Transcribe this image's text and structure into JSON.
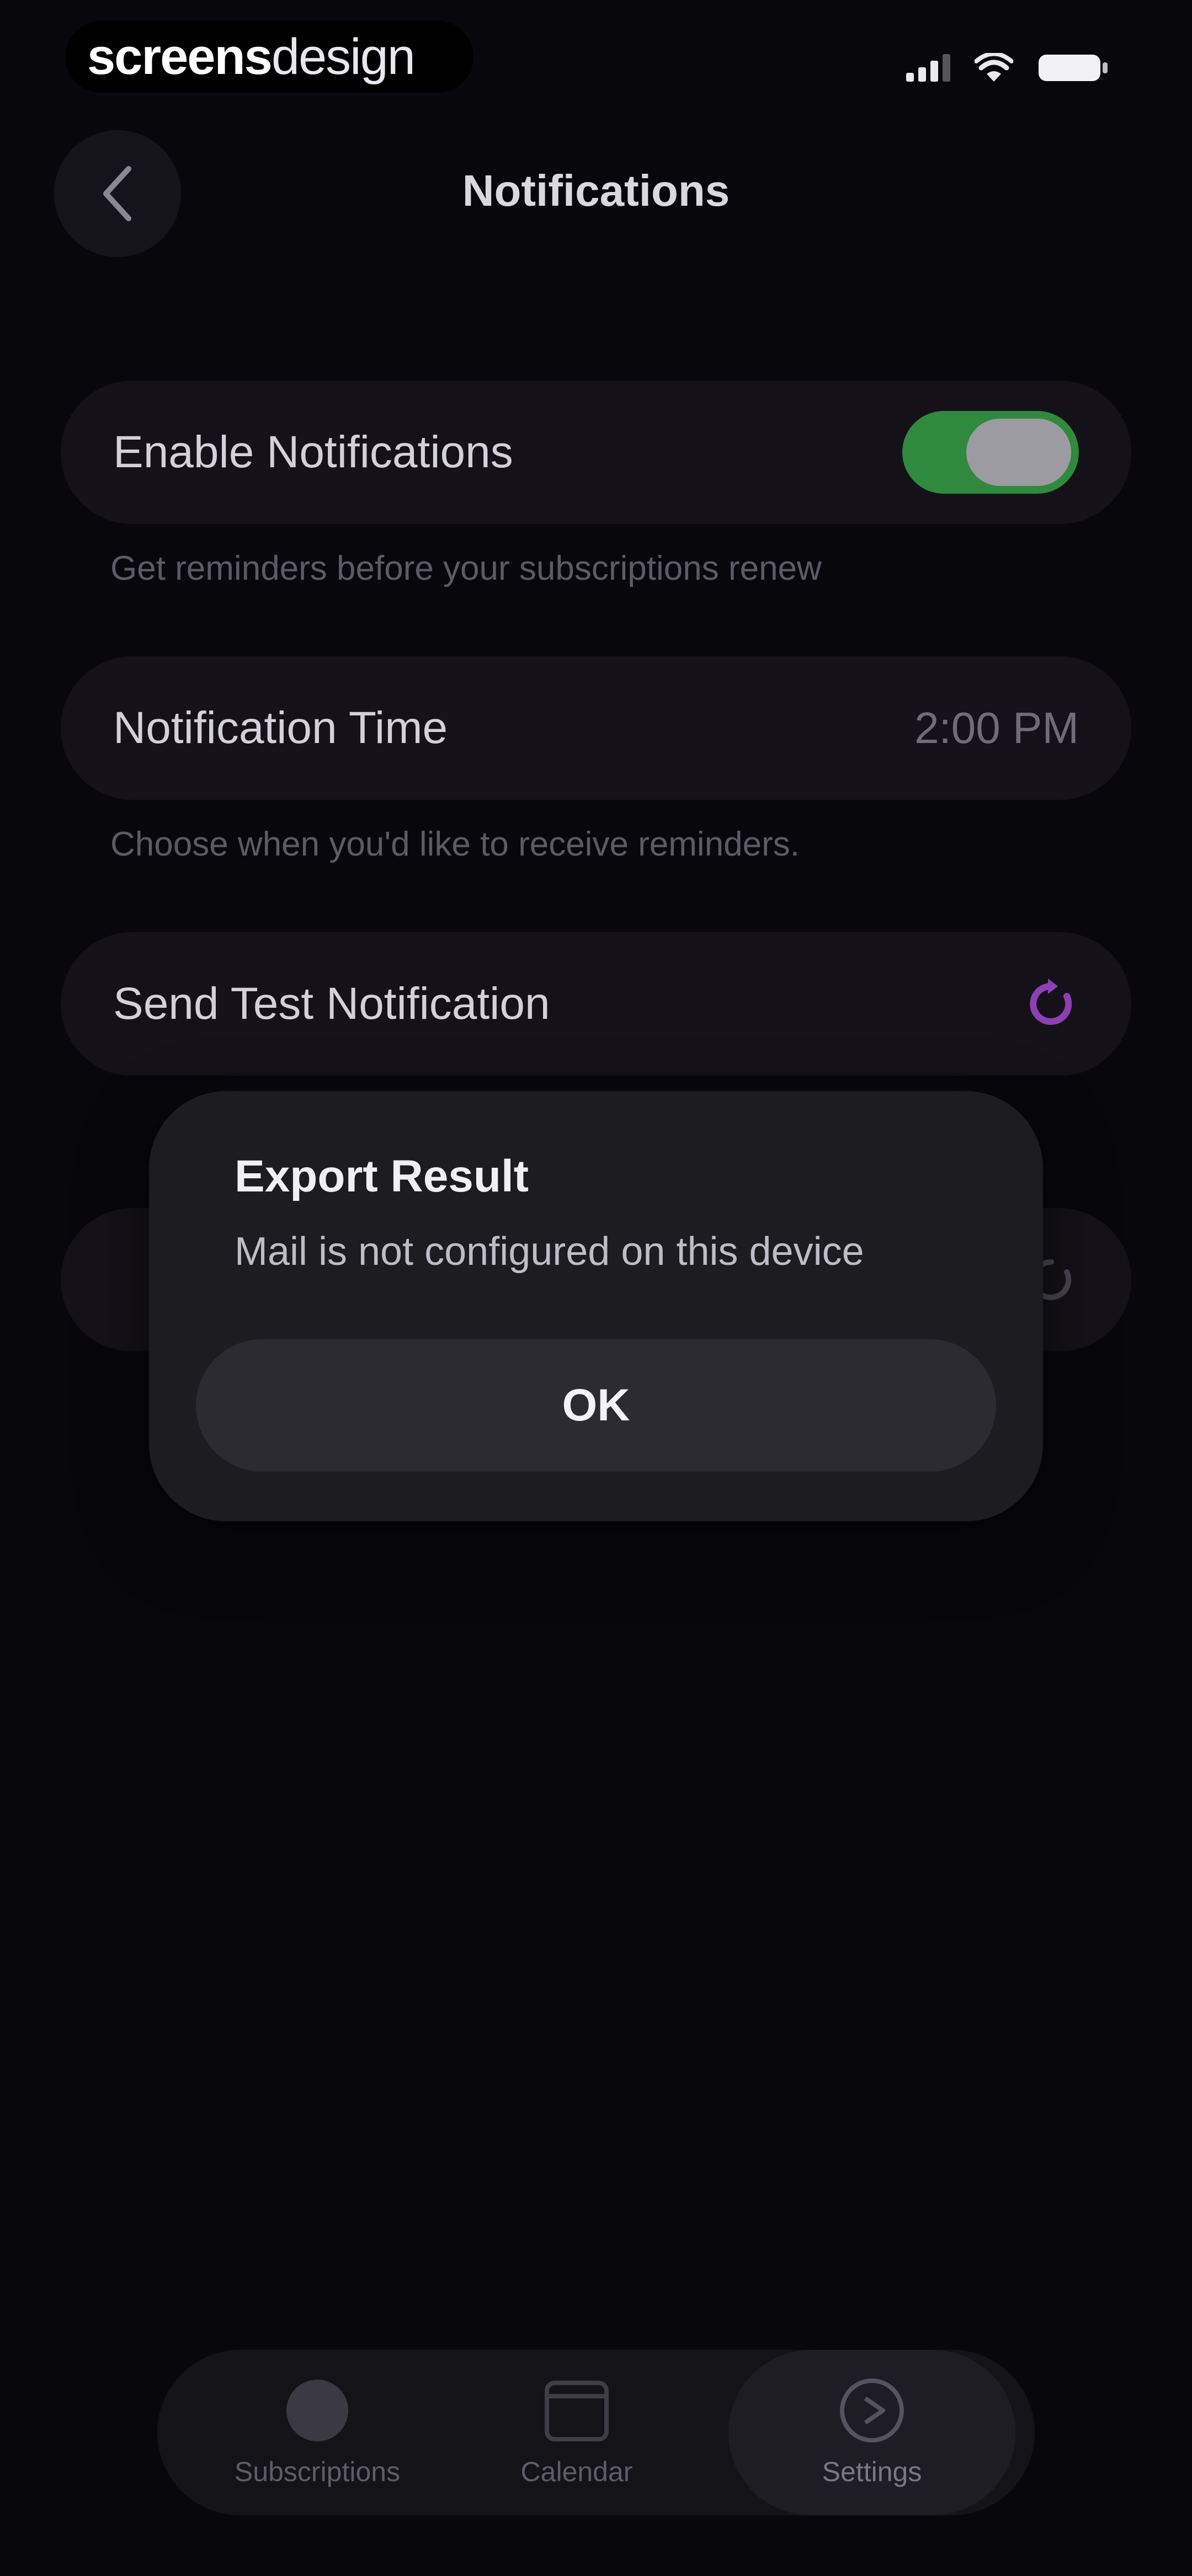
{
  "status_bar": {
    "brand_bold": "screens",
    "brand_light": "design",
    "icons": [
      "cellular-signal-icon",
      "wifi-icon",
      "battery-icon"
    ]
  },
  "header": {
    "back_icon": "chevron-left-icon",
    "title": "Notifications"
  },
  "settings": {
    "enable": {
      "label": "Enable Notifications",
      "description": "Get reminders before your subscriptions renew",
      "enabled": true
    },
    "time": {
      "label": "Notification Time",
      "value": "2:00 PM",
      "description": "Choose when you'd like to receive reminders."
    },
    "test": {
      "label": "Send Test Notification",
      "icon": "refresh-icon"
    }
  },
  "dialog": {
    "title": "Export Result",
    "message": "Mail is not configured on this device",
    "ok_label": "OK"
  },
  "tab_bar": {
    "items": [
      {
        "label": "Subscriptions",
        "icon": "circle-icon"
      },
      {
        "label": "Calendar",
        "icon": "calendar-icon"
      },
      {
        "label": "Settings",
        "icon": "play-circle-icon",
        "active": true
      }
    ]
  },
  "colors": {
    "background": "#08080C",
    "card": "#141218",
    "toggle_on": "#2F8A3D",
    "accent": "#8E3FB5",
    "dialog": "#1D1C21"
  }
}
